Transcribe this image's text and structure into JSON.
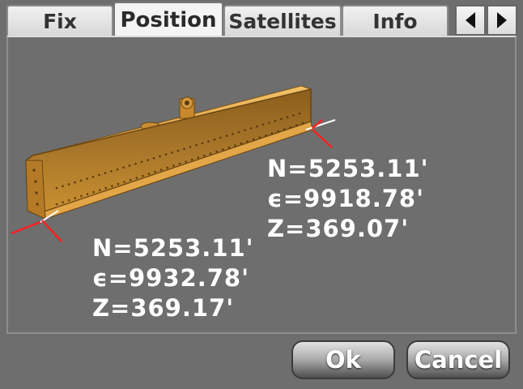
{
  "tabs": [
    {
      "label": "Fix",
      "active": false
    },
    {
      "label": "Position",
      "active": true
    },
    {
      "label": "Satellites",
      "active": false
    },
    {
      "label": "Info",
      "active": false
    }
  ],
  "nav": {
    "prev_icon": "triangle-left-icon",
    "next_icon": "triangle-right-icon"
  },
  "readouts": {
    "right_tip": {
      "n": "N=5253.11'",
      "e": "ϵ=9918.78'",
      "z": "Z=369.07'"
    },
    "left_tip": {
      "n": "N=5253.11'",
      "e": "ϵ=9932.78'",
      "z": "Z=369.17'"
    }
  },
  "buttons": {
    "ok": "Ok",
    "cancel": "Cancel"
  },
  "colors": {
    "background": "#6e6e6e",
    "blade": "#c98e33",
    "marker": "#ff2020"
  }
}
